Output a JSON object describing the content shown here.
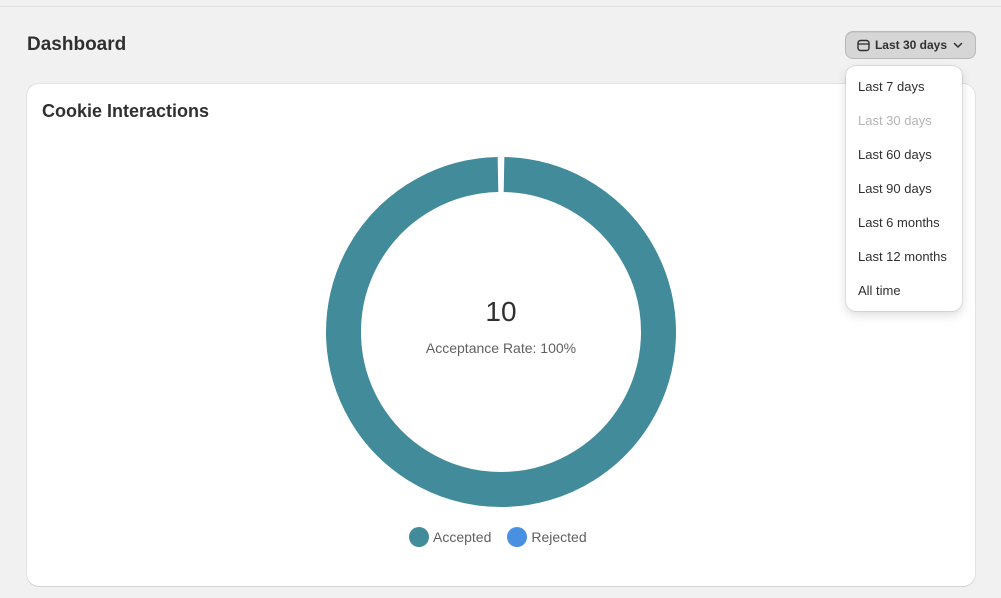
{
  "header": {
    "title": "Dashboard",
    "range_button_label": "Last 30 days"
  },
  "card": {
    "title": "Cookie Interactions",
    "center_value": "10",
    "center_caption": "Acceptance Rate: 100%"
  },
  "chart_data": {
    "type": "pie",
    "categories": [
      "Accepted",
      "Rejected"
    ],
    "values": [
      10,
      0
    ],
    "colors": [
      "#418b9b",
      "#4a90e2"
    ],
    "legend_position": "bottom"
  },
  "dropdown": {
    "selected": "Last 30 days",
    "options": [
      {
        "label": "Last 7 days",
        "disabled": false
      },
      {
        "label": "Last 30 days",
        "disabled": true
      },
      {
        "label": "Last 60 days",
        "disabled": false
      },
      {
        "label": "Last 90 days",
        "disabled": false
      },
      {
        "label": "Last 6 months",
        "disabled": false
      },
      {
        "label": "Last 12 months",
        "disabled": false
      },
      {
        "label": "All time",
        "disabled": false
      }
    ]
  },
  "icons": {
    "range_button_icon": "calendar-icon",
    "range_button_chevron": "chevron-down-icon"
  }
}
